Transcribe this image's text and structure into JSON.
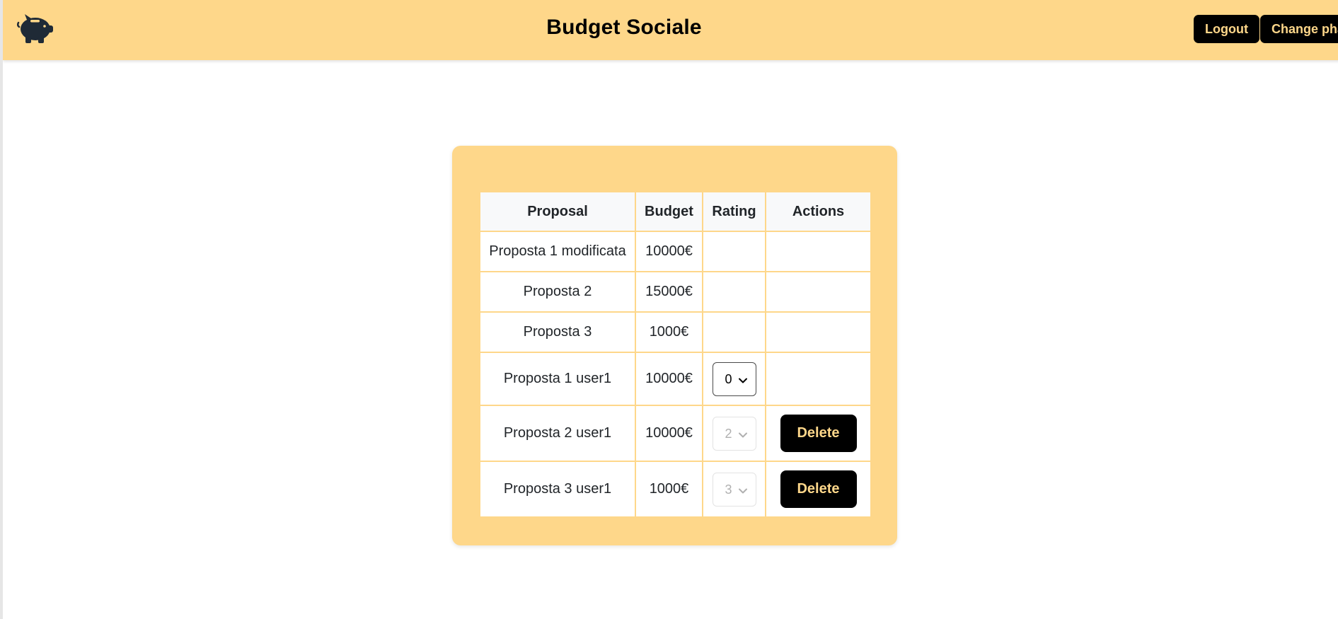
{
  "header": {
    "title": "Budget Sociale",
    "logo_icon": "piggy-bank-icon",
    "logout_label": "Logout",
    "change_phase_label": "Change phase"
  },
  "colors": {
    "accent": "#fed78a",
    "button_bg": "#000000",
    "button_text": "#fed78a"
  },
  "table": {
    "headers": {
      "proposal": "Proposal",
      "budget": "Budget",
      "rating": "Rating",
      "actions": "Actions"
    },
    "rows": [
      {
        "proposal": "Proposta 1 modificata",
        "budget": "10000€"
      },
      {
        "proposal": "Proposta 2",
        "budget": "15000€"
      },
      {
        "proposal": "Proposta 3",
        "budget": "1000€"
      },
      {
        "proposal": "Proposta 1 user1",
        "budget": "10000€",
        "rating": "0"
      },
      {
        "proposal": "Proposta 2 user1",
        "budget": "10000€",
        "rating": "2",
        "action": "Delete"
      },
      {
        "proposal": "Proposta 3 user1",
        "budget": "1000€",
        "rating": "3",
        "action": "Delete"
      }
    ]
  }
}
